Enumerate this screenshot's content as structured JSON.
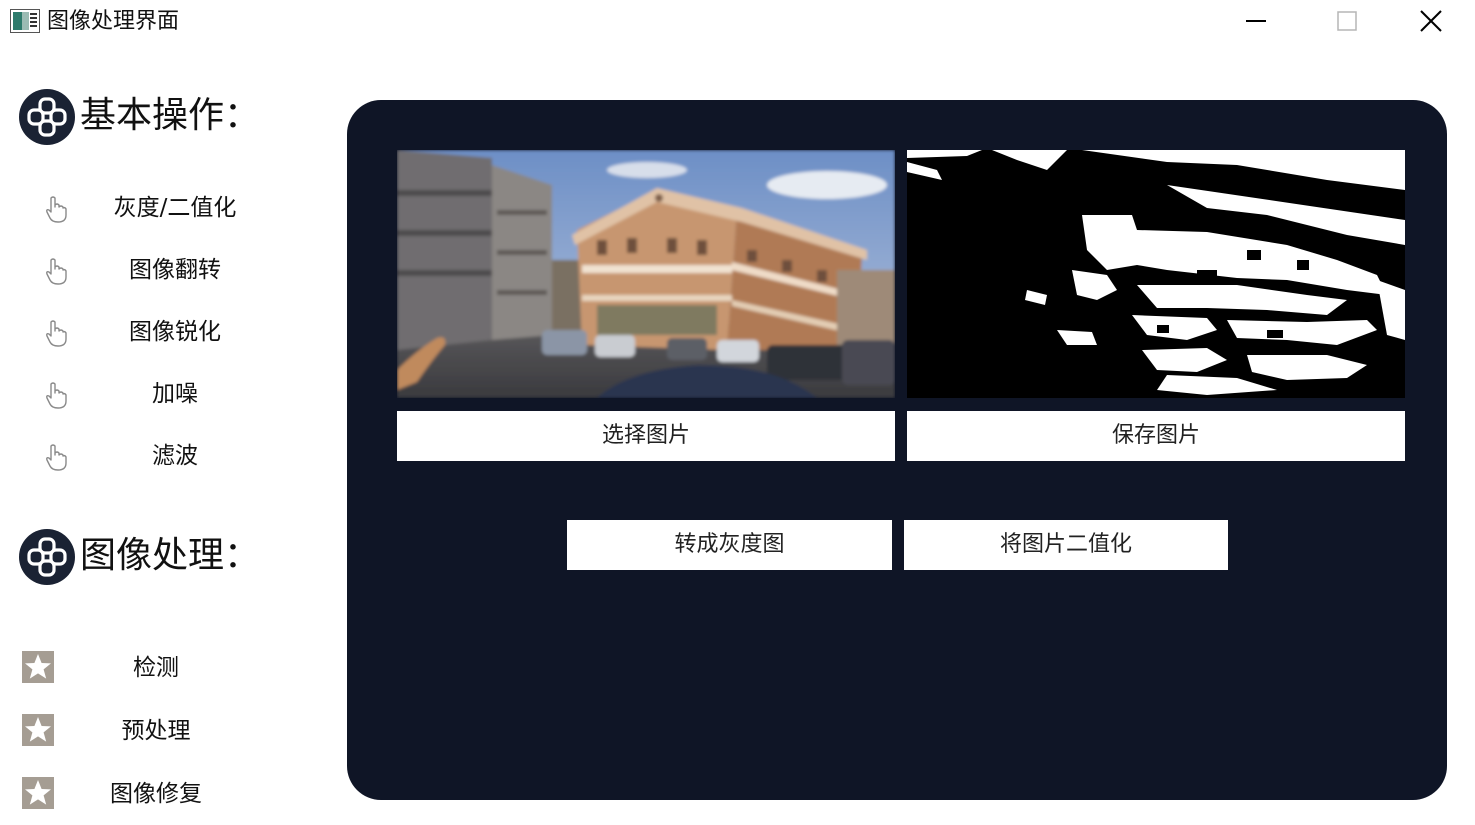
{
  "window": {
    "title": "图像处理界面"
  },
  "sidebar": {
    "basic_section": {
      "title": "基本操作：",
      "items": [
        {
          "label": "灰度/二值化"
        },
        {
          "label": "图像翻转"
        },
        {
          "label": "图像锐化"
        },
        {
          "label": "加噪"
        },
        {
          "label": "滤波"
        }
      ]
    },
    "processing_section": {
      "title": "图像处理：",
      "items": [
        {
          "label": "检测"
        },
        {
          "label": "预处理"
        },
        {
          "label": "图像修复"
        }
      ]
    }
  },
  "main": {
    "select_button": "选择图片",
    "save_button": "保存图片",
    "grayscale_button": "转成灰度图",
    "binarize_button": "将图片二值化",
    "original_image": {
      "icon": "street-photo"
    },
    "result_image": {
      "icon": "binarized-street-photo"
    }
  },
  "colors": {
    "panel_bg": "#0f1526",
    "button_bg": "#ffffff",
    "icon_dark": "#1a2233",
    "star_bg": "#a59d93"
  }
}
